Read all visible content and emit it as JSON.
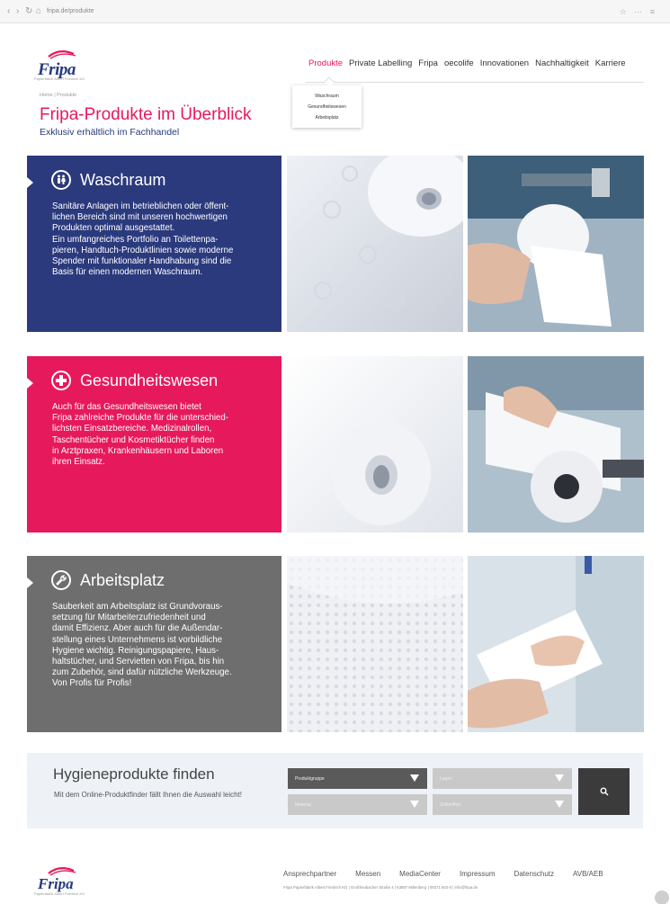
{
  "browser": {
    "url": "fripa.de/produkte",
    "nav_icons": [
      "back-icon",
      "reload-icon",
      "home-icon",
      "lock-icon"
    ]
  },
  "header": {
    "logo_text": "Fripa",
    "logo_tagline": "Papierfabrik Albert Friedrich KG",
    "nav": [
      "Produkte",
      "Private Labelling",
      "Fripa",
      "oecolife",
      "Innovationen",
      "Nachhaltigkeit",
      "Karriere"
    ],
    "active_nav": "Produkte",
    "dropdown": [
      "Waschraum",
      "Gesundheitswesen",
      "Arbeitsplatz"
    ]
  },
  "breadcrumb": "Home | Produkte",
  "title": "Fripa-Produkte im Überblick",
  "subtitle": "Exklusiv erhältlich im Fachhandel",
  "categories": [
    {
      "title": "Waschraum",
      "icon": "restroom-icon",
      "color": "#2b3a7d",
      "text": "Sanitäre Anlagen im betrieblichen oder öffent-\nlichen Bereich sind mit unseren hochwertigen\nProdukten optimal ausgestattet.\nEin umfangreiches Portfolio an Toilettenpa-\npieren, Handtuch-Produktlinien sowie moderne\nSpender mit funktionaler Handhabung sind die\nBasis für einen modernen Waschraum."
    },
    {
      "title": "Gesundheitswesen",
      "icon": "medical-cross-icon",
      "color": "#e6195d",
      "text": "Auch für das Gesundheitswesen bietet\nFripa zahlreiche Produkte für die unterschied-\nlichsten Einsatzbereiche. Medizinalrollen,\nTaschentücher und Kosmetiktücher finden\nin Arztpraxen, Krankenhäusern und Laboren\nihren Einsatz."
    },
    {
      "title": "Arbeitsplatz",
      "icon": "wrench-icon",
      "color": "#6e6e6e",
      "text": "Sauberkeit am Arbeitsplatz ist Grundvoraus-\nsetzung für Mitarbeiterzufriedenheit und\ndamit Effizienz. Aber auch für die Außendar-\nstellung eines Unternehmens ist vorbildliche\nHygiene wichtig. Reinigungspapiere, Haus-\nhaltstücher, und Servietten von Fripa, bis hin\nzum Zubehör, sind dafür nützliche Werkzeuge.\nVon Profis für Profis!"
    }
  ],
  "finder": {
    "title": "Hygieneprodukte finden",
    "desc": "Mit dem Online-Produktfinder fällt Ihnen die Auswahl leicht!",
    "selects": [
      "Produktgruppe",
      "Lagen",
      "Material",
      "Zellstoffart"
    ]
  },
  "footer": {
    "links": [
      "Ansprechpartner",
      "Messen",
      "MediaCenter",
      "Impressum",
      "Datenschutz",
      "AVB/AEB"
    ],
    "address": "Fripa Papierfabrik Albert Friedrich KG  |  Großheubacher Straße 4  |  63897 Miltenberg  |  09371 502-0  |  info@fripa.de"
  },
  "colors": {
    "brand_blue": "#253a7c",
    "brand_pink": "#e8195a",
    "select_dark": "#5a5a5a",
    "select_light": "#c9c9c9"
  }
}
